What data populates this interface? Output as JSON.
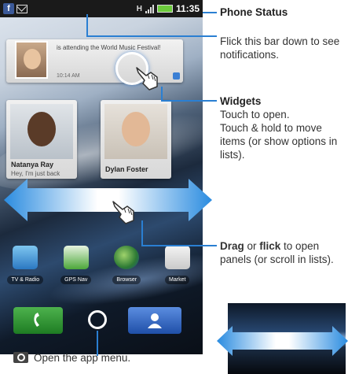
{
  "status_bar": {
    "time": "11:35"
  },
  "social_widget": {
    "status_text": "is attending the World Music Festival!",
    "timestamp": "10:14 AM"
  },
  "contacts": [
    {
      "name": "Natanya Ray",
      "message": "Hey, I'm just back"
    },
    {
      "name": "Dylan Foster",
      "message": ""
    }
  ],
  "apps": [
    {
      "label": "TV & Radio"
    },
    {
      "label": "GPS Nav"
    },
    {
      "label": "Browser"
    },
    {
      "label": "Market"
    }
  ],
  "annotations": {
    "phone_status": {
      "title": "Phone Status"
    },
    "notifications": {
      "text": "Flick this bar down to see notifications."
    },
    "widgets": {
      "title": "Widgets",
      "line1": "Touch to open.",
      "line2": "Touch & hold to move items (or show options in lists)."
    },
    "drag": {
      "word1": "Drag",
      "word_or": " or ",
      "word2": "flick",
      "rest": " to open panels (or scroll in lists)."
    },
    "app_menu": {
      "text": "Open the app menu."
    }
  },
  "colors": {
    "callout_line": "#2a7fd2",
    "status_bar": "#1a1a1a",
    "phone_button": "#2f9a34",
    "contacts_button": "#3a6fcf"
  }
}
